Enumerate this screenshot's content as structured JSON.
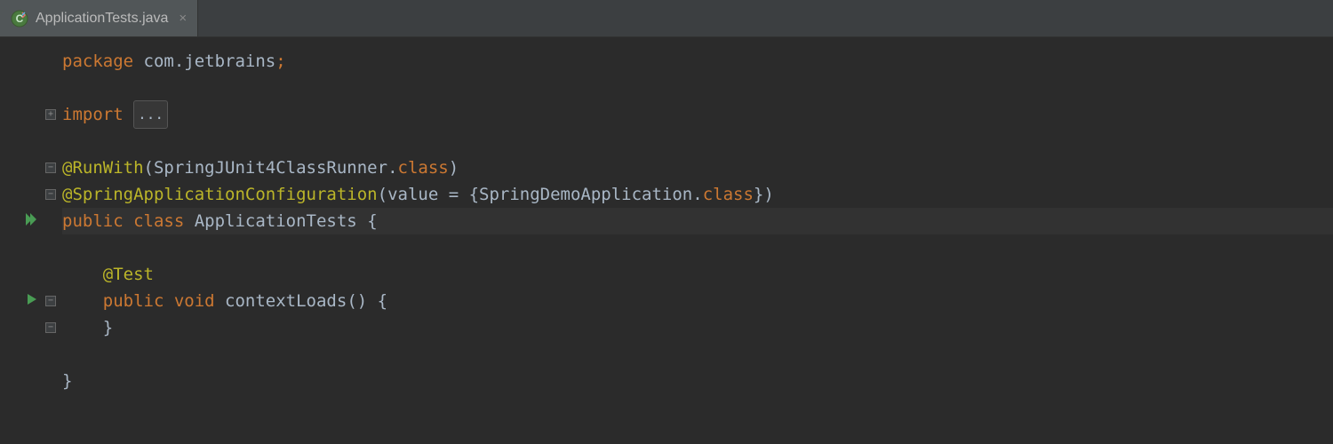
{
  "tab": {
    "filename": "ApplicationTests.java",
    "close": "×"
  },
  "code": {
    "line1": {
      "package_kw": "package ",
      "package_name": "com.jetbrains",
      "semi": ";"
    },
    "line3": {
      "import_kw": "import ",
      "dots": "..."
    },
    "line5": {
      "anno": "@RunWith",
      "open": "(",
      "cls": "SpringJUnit4ClassRunner",
      "dot": ".",
      "class_kw": "class",
      "close": ")"
    },
    "line6": {
      "anno": "@SpringApplicationConfiguration",
      "open": "(",
      "param": "value = {",
      "cls": "SpringDemoApplication",
      "dot": ".",
      "class_kw": "class",
      "close": "})"
    },
    "line7": {
      "public_kw": "public class ",
      "name": "ApplicationTests ",
      "brace": "{"
    },
    "line9": {
      "indent": "    ",
      "anno": "@Test"
    },
    "line10": {
      "indent": "    ",
      "mods": "public void ",
      "name": "contextLoads",
      "parens": "() {"
    },
    "line11": {
      "indent": "    ",
      "brace": "}"
    },
    "line13": {
      "brace": "}"
    }
  }
}
